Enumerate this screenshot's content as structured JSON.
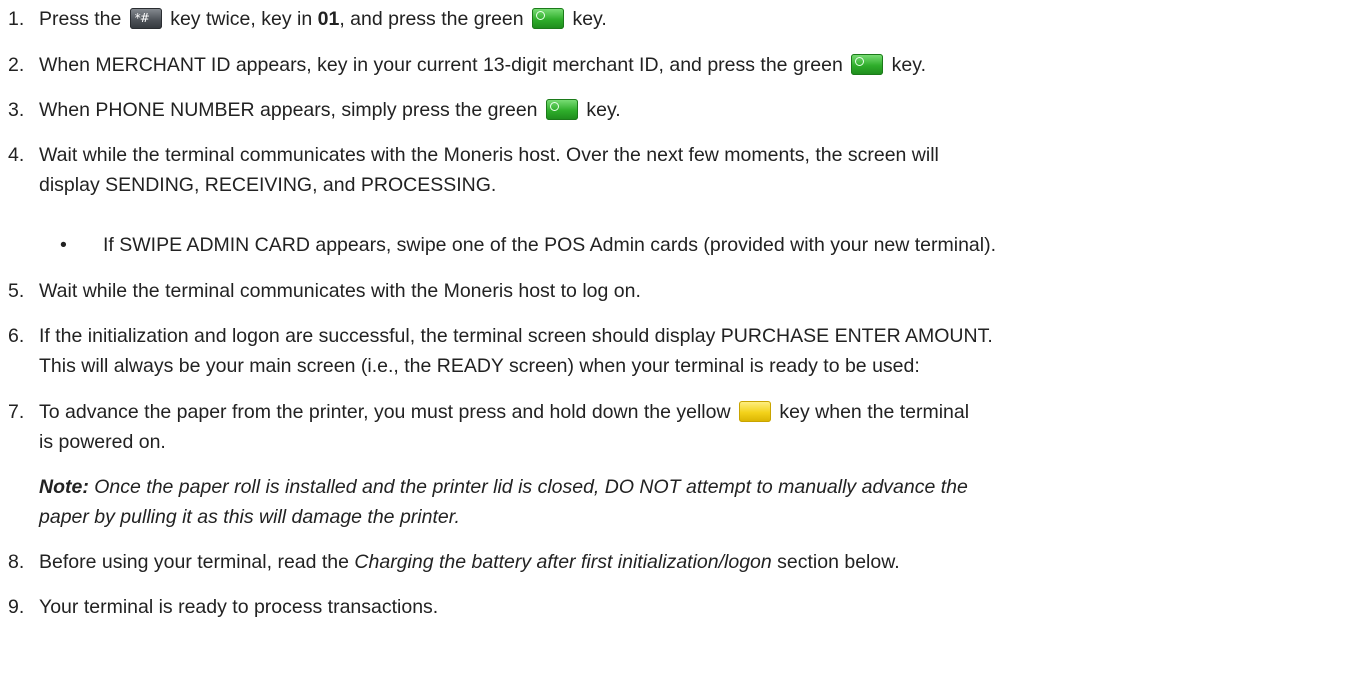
{
  "steps": [
    {
      "num": "1.",
      "a": "Press the ",
      "key1": "*#",
      "b": " key twice, key in ",
      "code": "01",
      "c": ", and press the green ",
      "d": " key."
    },
    {
      "num": "2.",
      "a": "When MERCHANT ID appears, key in your current 13-digit merchant ID, and press the green ",
      "b": " key."
    },
    {
      "num": "3.",
      "a": "When PHONE NUMBER appears, simply press the green ",
      "b": " key."
    },
    {
      "num": "4.",
      "line1": "Wait while the terminal communicates with the Moneris host. Over the next few moments, the screen will",
      "line2": "display SENDING, RECEIVING, and PROCESSING.",
      "bullet": "If SWIPE ADMIN CARD appears, swipe one of the POS Admin cards (provided with your new terminal)."
    },
    {
      "num": "5.",
      "text": "Wait while the terminal communicates with the Moneris host to log on."
    },
    {
      "num": "6.",
      "line1": "If the initialization and logon are successful, the terminal screen should display PURCHASE ENTER AMOUNT.",
      "line2": "This will always be your main screen (i.e., the READY screen) when your terminal is ready to be used:"
    },
    {
      "num": "7.",
      "a": "To advance the paper from the printer, you must press and hold down the yellow ",
      "b": " key when the terminal",
      "line2": "is powered on.",
      "note_label": "Note:",
      "note_line1": " Once the paper roll is installed and the printer lid is closed, DO NOT attempt to manually advance the",
      "note_line2": "paper by pulling it as this will damage the printer."
    },
    {
      "num": "8.",
      "a": "Before using your terminal, read the ",
      "emph": "Charging the battery after first initialization/logon",
      "b": " section below."
    },
    {
      "num": "9.",
      "text": "Your terminal is ready to process transactions."
    }
  ],
  "bullet_glyph": "•",
  "icons": {
    "function_key": "function-hash-key-icon",
    "green_key": "green-ok-key-icon",
    "yellow_key": "yellow-key-icon"
  },
  "colors": {
    "text": "#222222",
    "green_key": "#2fae2b",
    "yellow_key": "#f3d21a",
    "function_key": "#4b5056"
  }
}
